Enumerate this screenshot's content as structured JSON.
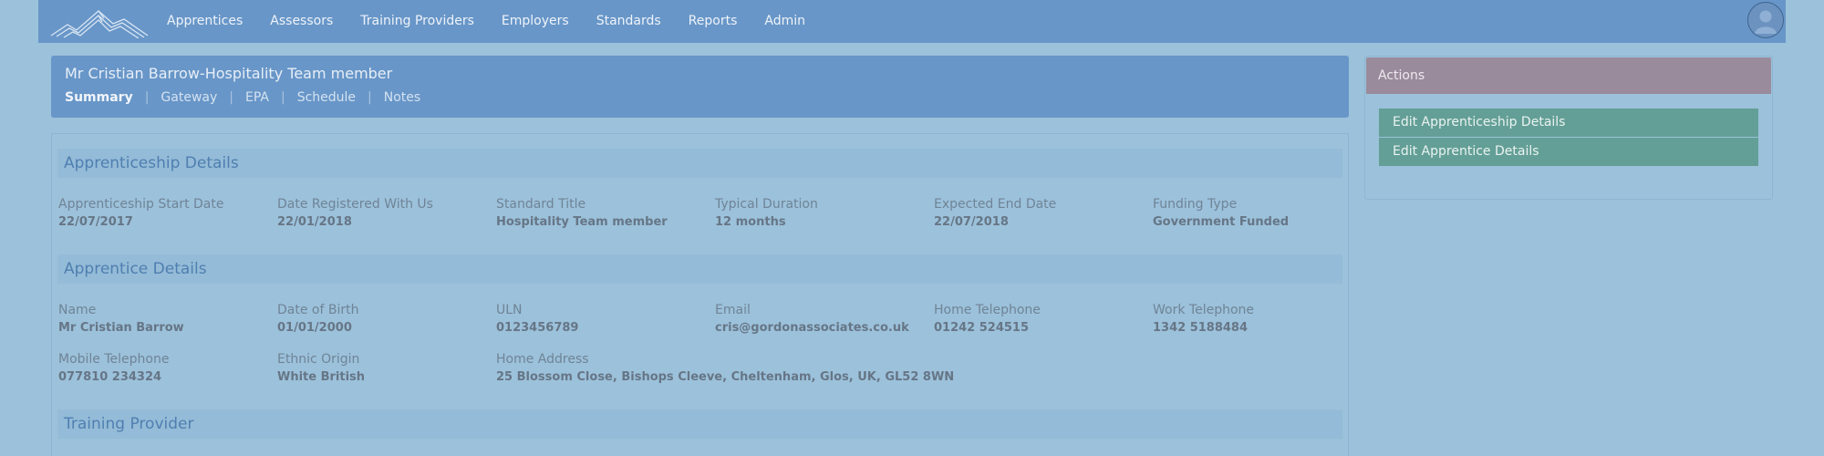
{
  "nav": {
    "items": [
      "Apprentices",
      "Assessors",
      "Training Providers",
      "Employers",
      "Standards",
      "Reports",
      "Admin"
    ]
  },
  "header": {
    "title": "Mr Cristian Barrow-Hospitality Team member",
    "tabs": [
      "Summary",
      "Gateway",
      "EPA",
      "Schedule",
      "Notes"
    ],
    "active_tab": "Summary"
  },
  "apprenticeship": {
    "title": "Apprenticeship Details",
    "fields": [
      {
        "label": "Apprenticeship Start Date",
        "value": "22/07/2017"
      },
      {
        "label": "Date Registered With Us",
        "value": "22/01/2018"
      },
      {
        "label": "Standard Title",
        "value": "Hospitality Team member"
      },
      {
        "label": "Typical Duration",
        "value": "12 months"
      },
      {
        "label": "Expected End Date",
        "value": "22/07/2018"
      },
      {
        "label": "Funding Type",
        "value": "Government Funded"
      }
    ]
  },
  "apprentice": {
    "title": "Apprentice Details",
    "fields": [
      {
        "label": "Name",
        "value": "Mr Cristian Barrow"
      },
      {
        "label": "Date of Birth",
        "value": "01/01/2000"
      },
      {
        "label": "ULN",
        "value": "0123456789"
      },
      {
        "label": "Email",
        "value": "cris@gordonassociates.co.uk"
      },
      {
        "label": "Home Telephone",
        "value": "01242 524515"
      },
      {
        "label": "Work Telephone",
        "value": "1342 5188484"
      },
      {
        "label": "Mobile Telephone",
        "value": "077810 234324"
      },
      {
        "label": "Ethnic Origin",
        "value": "White British"
      },
      {
        "label": "Home Address",
        "value": "25 Blossom Close, Bishops Cleeve, Cheltenham, Glos, UK, GL52 8WN"
      }
    ]
  },
  "training_provider": {
    "title": "Training Provider"
  },
  "actions": {
    "title": "Actions",
    "buttons": [
      "Edit Apprenticeship Details",
      "Edit Apprentice Details"
    ]
  },
  "icons": {
    "logo": "mountain-logo-icon",
    "avatar": "user-avatar-icon"
  },
  "colors": {
    "navbar": "#6896c8",
    "background": "#9cc1db",
    "actions_header": "#998b9b",
    "action_button": "#639f96",
    "section_title": "#4f7fb1"
  }
}
